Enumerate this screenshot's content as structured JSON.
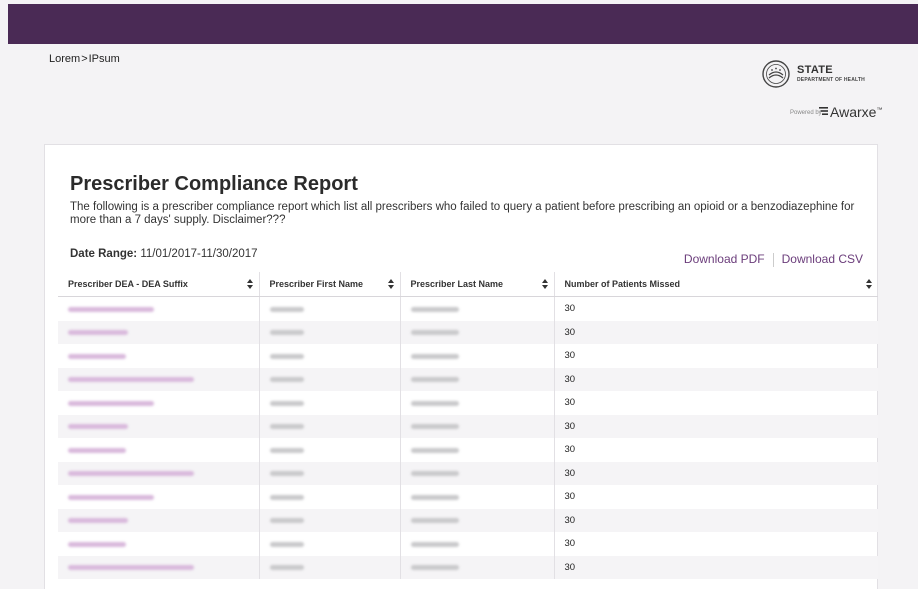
{
  "breadcrumb": {
    "parent": "Lorem",
    "separator": ">",
    "current": "IPsum"
  },
  "logo": {
    "state": "STATE",
    "department": "DEPARTMENT OF HEALTH",
    "powered_by": "Powered by",
    "brand": "Awarxe",
    "brand_tm": "™"
  },
  "report": {
    "title": "Prescriber Compliance Report",
    "description": "The following is a prescriber compliance report which list all prescribers who failed to query a patient before prescribing an opioid or a benzodiazephine for more than a 7 days' supply. Disclaimer???",
    "date_range_label": "Date Range:",
    "date_range_value": "11/01/2017-11/30/2017",
    "download_pdf": "Download PDF",
    "download_csv": "Download CSV"
  },
  "table": {
    "columns": [
      "Prescriber DEA - DEA Suffix",
      "Prescriber First Name",
      "Prescriber Last Name",
      "Number of Patients Missed"
    ],
    "rows": [
      {
        "missed": "30"
      },
      {
        "missed": "30"
      },
      {
        "missed": "30"
      },
      {
        "missed": "30"
      },
      {
        "missed": "30"
      },
      {
        "missed": "30"
      },
      {
        "missed": "30"
      },
      {
        "missed": "30"
      },
      {
        "missed": "30"
      },
      {
        "missed": "30"
      },
      {
        "missed": "30"
      },
      {
        "missed": "30"
      }
    ]
  },
  "colors": {
    "topbar": "#4a2a55",
    "link": "#6b3d7b",
    "redacted_dea": "#d9b9dc",
    "redacted_name": "#c9c9cb"
  }
}
